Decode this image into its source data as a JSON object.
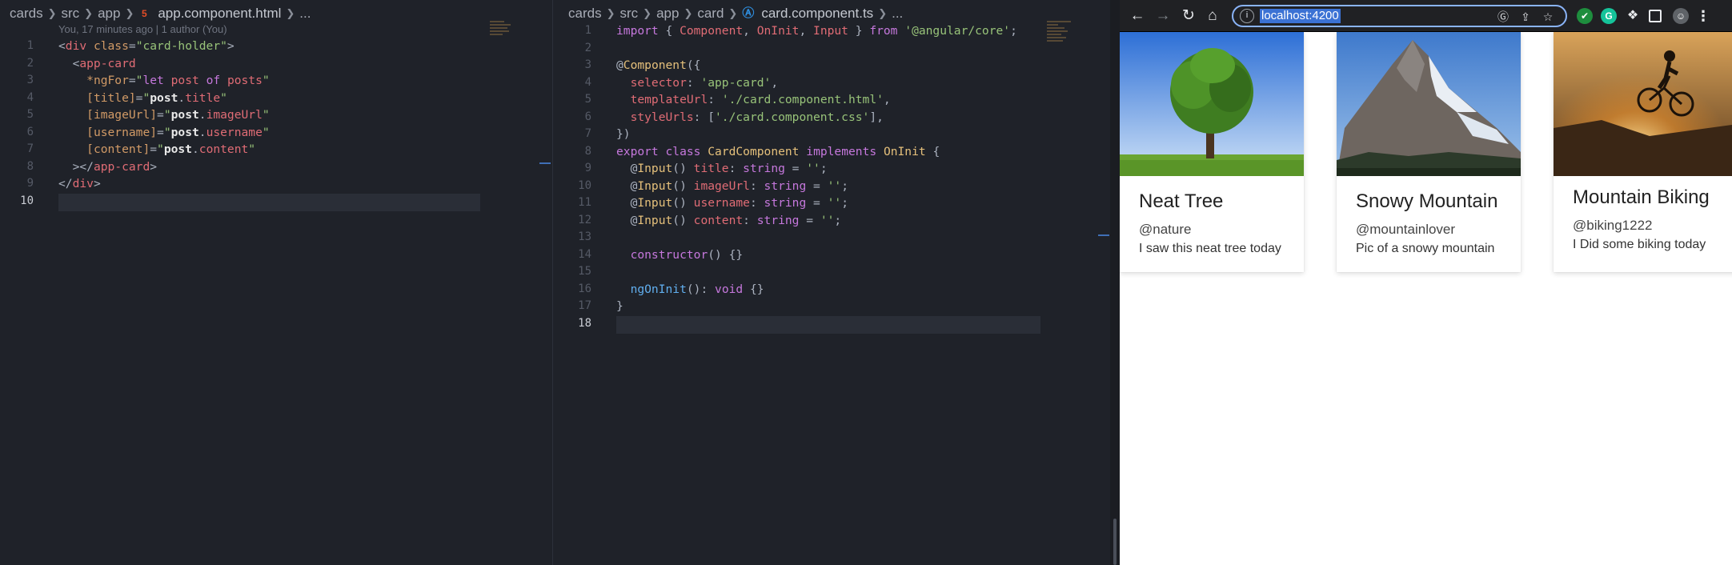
{
  "left_editor": {
    "breadcrumb": [
      "cards",
      "src",
      "app"
    ],
    "file_icon": "html5-icon",
    "file_name": "app.component.html",
    "breadcrumb_tail": "...",
    "blame": "You, 17 minutes ago | 1 author (You)",
    "line_numbers": [
      "1",
      "2",
      "3",
      "4",
      "5",
      "6",
      "7",
      "8",
      "9",
      "10"
    ],
    "lines": [
      [
        [
          "tk-p",
          "<"
        ],
        [
          "tk-tag",
          "div"
        ],
        [
          "tk-p",
          " "
        ],
        [
          "tk-attr",
          "class"
        ],
        [
          "tk-p",
          "="
        ],
        [
          "tk-str",
          "\"card-holder\""
        ],
        [
          "tk-p",
          ">"
        ]
      ],
      [
        [
          "tk-p",
          "  <"
        ],
        [
          "tk-tag",
          "app-card"
        ]
      ],
      [
        [
          "tk-p",
          "    "
        ],
        [
          "tk-attr",
          "*ngFor"
        ],
        [
          "tk-p",
          "="
        ],
        [
          "tk-str",
          "\""
        ],
        [
          "tk-kw",
          "let"
        ],
        [
          "tk-str",
          " "
        ],
        [
          "tk-prop",
          "post"
        ],
        [
          "tk-str",
          " "
        ],
        [
          "tk-kw",
          "of"
        ],
        [
          "tk-str",
          " "
        ],
        [
          "tk-prop",
          "posts"
        ],
        [
          "tk-str",
          "\""
        ]
      ],
      [
        [
          "tk-p",
          "    "
        ],
        [
          "tk-attr",
          "[title]"
        ],
        [
          "tk-p",
          "="
        ],
        [
          "tk-str",
          "\""
        ],
        [
          "tk-bold",
          "post"
        ],
        [
          "tk-p",
          "."
        ],
        [
          "tk-prop",
          "title"
        ],
        [
          "tk-str",
          "\""
        ]
      ],
      [
        [
          "tk-p",
          "    "
        ],
        [
          "tk-attr",
          "[imageUrl]"
        ],
        [
          "tk-p",
          "="
        ],
        [
          "tk-str",
          "\""
        ],
        [
          "tk-bold",
          "post"
        ],
        [
          "tk-p",
          "."
        ],
        [
          "tk-prop",
          "imageUrl"
        ],
        [
          "tk-str",
          "\""
        ]
      ],
      [
        [
          "tk-p",
          "    "
        ],
        [
          "tk-attr",
          "[username]"
        ],
        [
          "tk-p",
          "="
        ],
        [
          "tk-str",
          "\""
        ],
        [
          "tk-bold",
          "post"
        ],
        [
          "tk-p",
          "."
        ],
        [
          "tk-prop",
          "username"
        ],
        [
          "tk-str",
          "\""
        ]
      ],
      [
        [
          "tk-p",
          "    "
        ],
        [
          "tk-attr",
          "[content]"
        ],
        [
          "tk-p",
          "="
        ],
        [
          "tk-str",
          "\""
        ],
        [
          "tk-bold",
          "post"
        ],
        [
          "tk-p",
          "."
        ],
        [
          "tk-prop",
          "content"
        ],
        [
          "tk-str",
          "\""
        ]
      ],
      [
        [
          "tk-p",
          "  ></"
        ],
        [
          "tk-tag",
          "app-card"
        ],
        [
          "tk-p",
          ">"
        ]
      ],
      [
        [
          "tk-p",
          "</"
        ],
        [
          "tk-tag",
          "div"
        ],
        [
          "tk-p",
          ">"
        ]
      ],
      [
        [
          "tk-p",
          ""
        ]
      ]
    ],
    "active_line": "10"
  },
  "mid_editor": {
    "breadcrumb": [
      "cards",
      "src",
      "app",
      "card"
    ],
    "file_icon": "angular-icon",
    "file_name": "card.component.ts",
    "breadcrumb_tail": "...",
    "line_numbers": [
      "1",
      "2",
      "3",
      "4",
      "5",
      "6",
      "7",
      "8",
      "9",
      "10",
      "11",
      "12",
      "13",
      "14",
      "15",
      "16",
      "17",
      "18"
    ],
    "lines": [
      [
        [
          "tk-kw",
          "import"
        ],
        [
          "tk-p",
          " { "
        ],
        [
          "tk-tag",
          "Component"
        ],
        [
          "tk-p",
          ", "
        ],
        [
          "tk-tag",
          "OnInit"
        ],
        [
          "tk-p",
          ", "
        ],
        [
          "tk-tag",
          "Input"
        ],
        [
          "tk-p",
          " } "
        ],
        [
          "tk-kw",
          "from"
        ],
        [
          "tk-p",
          " "
        ],
        [
          "tk-str",
          "'@angular/core'"
        ],
        [
          "tk-p",
          ";"
        ]
      ],
      [
        [
          "tk-p",
          ""
        ]
      ],
      [
        [
          "tk-p",
          "@"
        ],
        [
          "tk-id",
          "Component"
        ],
        [
          "tk-p",
          "({"
        ]
      ],
      [
        [
          "tk-p",
          "  "
        ],
        [
          "tk-prop",
          "selector"
        ],
        [
          "tk-p",
          ": "
        ],
        [
          "tk-str",
          "'app-card'"
        ],
        [
          "tk-p",
          ","
        ]
      ],
      [
        [
          "tk-p",
          "  "
        ],
        [
          "tk-prop",
          "templateUrl"
        ],
        [
          "tk-p",
          ": "
        ],
        [
          "tk-str",
          "'./card.component.html'"
        ],
        [
          "tk-p",
          ","
        ]
      ],
      [
        [
          "tk-p",
          "  "
        ],
        [
          "tk-prop",
          "styleUrls"
        ],
        [
          "tk-p",
          ": ["
        ],
        [
          "tk-str",
          "'./card.component.css'"
        ],
        [
          "tk-p",
          "],"
        ]
      ],
      [
        [
          "tk-p",
          "})"
        ]
      ],
      [
        [
          "tk-kw",
          "export"
        ],
        [
          "tk-p",
          " "
        ],
        [
          "tk-kw",
          "class"
        ],
        [
          "tk-p",
          " "
        ],
        [
          "tk-id",
          "CardComponent"
        ],
        [
          "tk-p",
          " "
        ],
        [
          "tk-kw",
          "implements"
        ],
        [
          "tk-p",
          " "
        ],
        [
          "tk-id",
          "OnInit"
        ],
        [
          "tk-p",
          " {"
        ]
      ],
      [
        [
          "tk-p",
          "  @"
        ],
        [
          "tk-id",
          "Input"
        ],
        [
          "tk-p",
          "() "
        ],
        [
          "tk-prop",
          "title"
        ],
        [
          "tk-p",
          ": "
        ],
        [
          "tk-kw",
          "string"
        ],
        [
          "tk-p",
          " = "
        ],
        [
          "tk-str",
          "''"
        ],
        [
          "tk-p",
          ";"
        ]
      ],
      [
        [
          "tk-p",
          "  @"
        ],
        [
          "tk-id",
          "Input"
        ],
        [
          "tk-p",
          "() "
        ],
        [
          "tk-prop",
          "imageUrl"
        ],
        [
          "tk-p",
          ": "
        ],
        [
          "tk-kw",
          "string"
        ],
        [
          "tk-p",
          " = "
        ],
        [
          "tk-str",
          "''"
        ],
        [
          "tk-p",
          ";"
        ]
      ],
      [
        [
          "tk-p",
          "  @"
        ],
        [
          "tk-id",
          "Input"
        ],
        [
          "tk-p",
          "() "
        ],
        [
          "tk-prop",
          "username"
        ],
        [
          "tk-p",
          ": "
        ],
        [
          "tk-kw",
          "string"
        ],
        [
          "tk-p",
          " = "
        ],
        [
          "tk-str",
          "''"
        ],
        [
          "tk-p",
          ";"
        ]
      ],
      [
        [
          "tk-p",
          "  @"
        ],
        [
          "tk-id",
          "Input"
        ],
        [
          "tk-p",
          "() "
        ],
        [
          "tk-prop",
          "content"
        ],
        [
          "tk-p",
          ": "
        ],
        [
          "tk-kw",
          "string"
        ],
        [
          "tk-p",
          " = "
        ],
        [
          "tk-str",
          "''"
        ],
        [
          "tk-p",
          ";"
        ]
      ],
      [
        [
          "tk-p",
          ""
        ]
      ],
      [
        [
          "tk-p",
          "  "
        ],
        [
          "tk-kw",
          "constructor"
        ],
        [
          "tk-p",
          "() {}"
        ]
      ],
      [
        [
          "tk-p",
          ""
        ]
      ],
      [
        [
          "tk-p",
          "  "
        ],
        [
          "tk-fn",
          "ngOnInit"
        ],
        [
          "tk-p",
          "(): "
        ],
        [
          "tk-kw",
          "void"
        ],
        [
          "tk-p",
          " {}"
        ]
      ],
      [
        [
          "tk-p",
          "}"
        ]
      ],
      [
        [
          "tk-p",
          ""
        ]
      ]
    ],
    "active_line": "18"
  },
  "browser": {
    "url": "localhost:4200",
    "toolbar_icons": [
      "back-icon",
      "forward-icon",
      "reload-icon",
      "home-icon"
    ],
    "extension_icons": [
      "google-lens-icon",
      "share-icon",
      "bookmark-star-icon",
      "vpn-shield-icon",
      "grammarly-icon",
      "puzzle-extensions-icon",
      "side-panel-icon",
      "profile-avatar-icon",
      "more-menu-icon"
    ],
    "cards": [
      {
        "title": "Neat Tree",
        "username": "@nature",
        "content": "I saw this neat tree today",
        "image": "tree-photo"
      },
      {
        "title": "Snowy Mountain",
        "username": "@mountainlover",
        "content": "Pic of a snowy mountain",
        "image": "mountain-photo"
      },
      {
        "title": "Mountain Biking",
        "username": "@biking1222",
        "content": "I Did some biking today",
        "image": "biking-photo"
      }
    ]
  }
}
